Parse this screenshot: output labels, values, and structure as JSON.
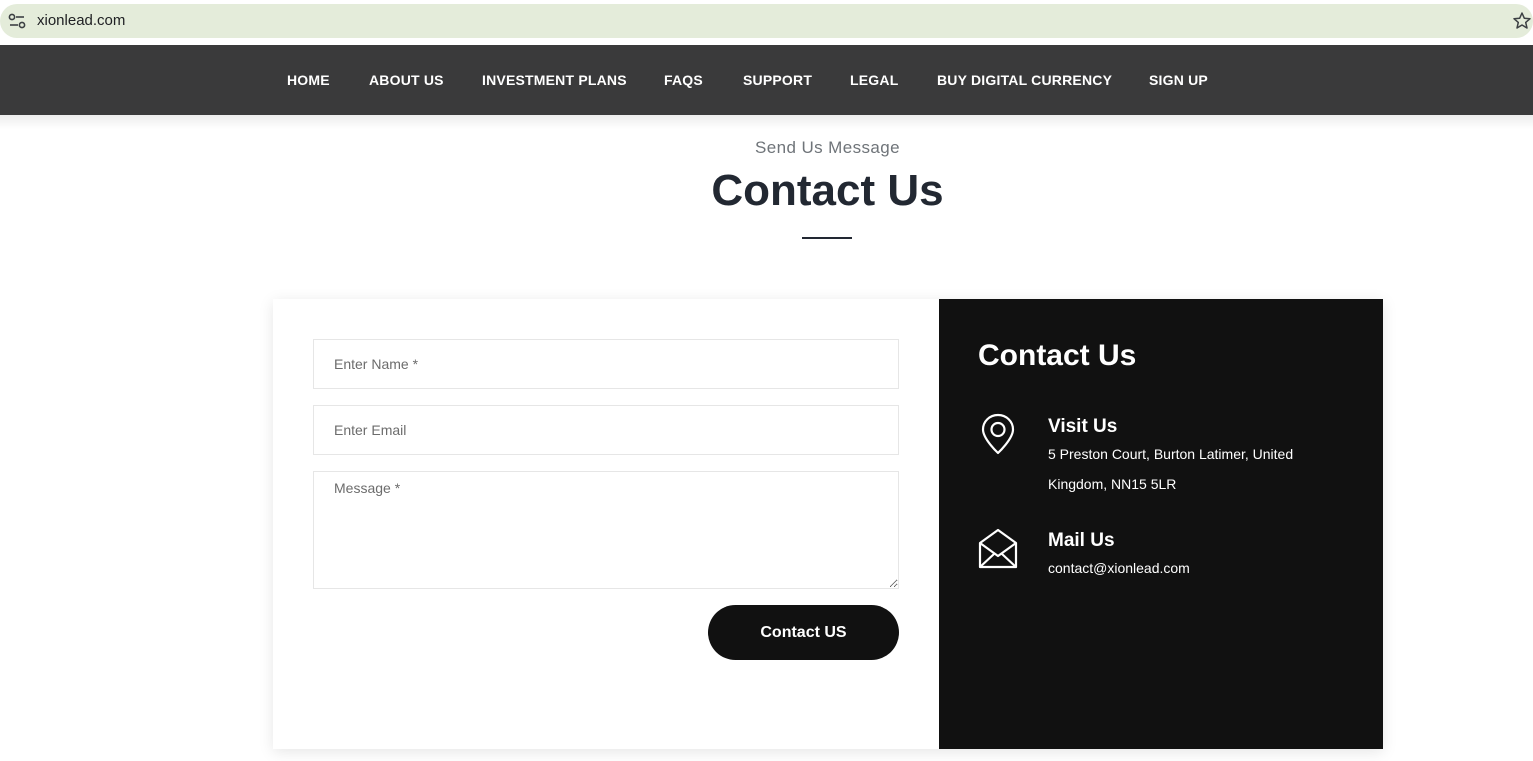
{
  "browser": {
    "url": "xionlead.com"
  },
  "nav": {
    "items": [
      "HOME",
      "ABOUT US",
      "INVESTMENT PLANS",
      "FAQS",
      "SUPPORT",
      "LEGAL",
      "BUY DIGITAL CURRENCY",
      "SIGN UP"
    ]
  },
  "section": {
    "subtitle": "Send Us Message",
    "title": "Contact Us"
  },
  "form": {
    "name_placeholder": "Enter Name *",
    "email_placeholder": "Enter Email",
    "message_placeholder": "Message *",
    "submit_label": "Contact US"
  },
  "info": {
    "title": "Contact Us",
    "visit_heading": "Visit Us",
    "visit_address": "5 Preston Court, Burton Latimer, United Kingdom, NN15 5LR",
    "mail_heading": "Mail Us",
    "mail_email": "contact@xionlead.com",
    "visit_icon": "map-pin-icon",
    "mail_icon": "open-envelope-icon"
  },
  "colors": {
    "nav_bg": "#3a3a3b",
    "info_bg": "#111111",
    "button_bg": "#111111",
    "title_color": "#222832",
    "url_bar_bg": "#e4ecda"
  }
}
